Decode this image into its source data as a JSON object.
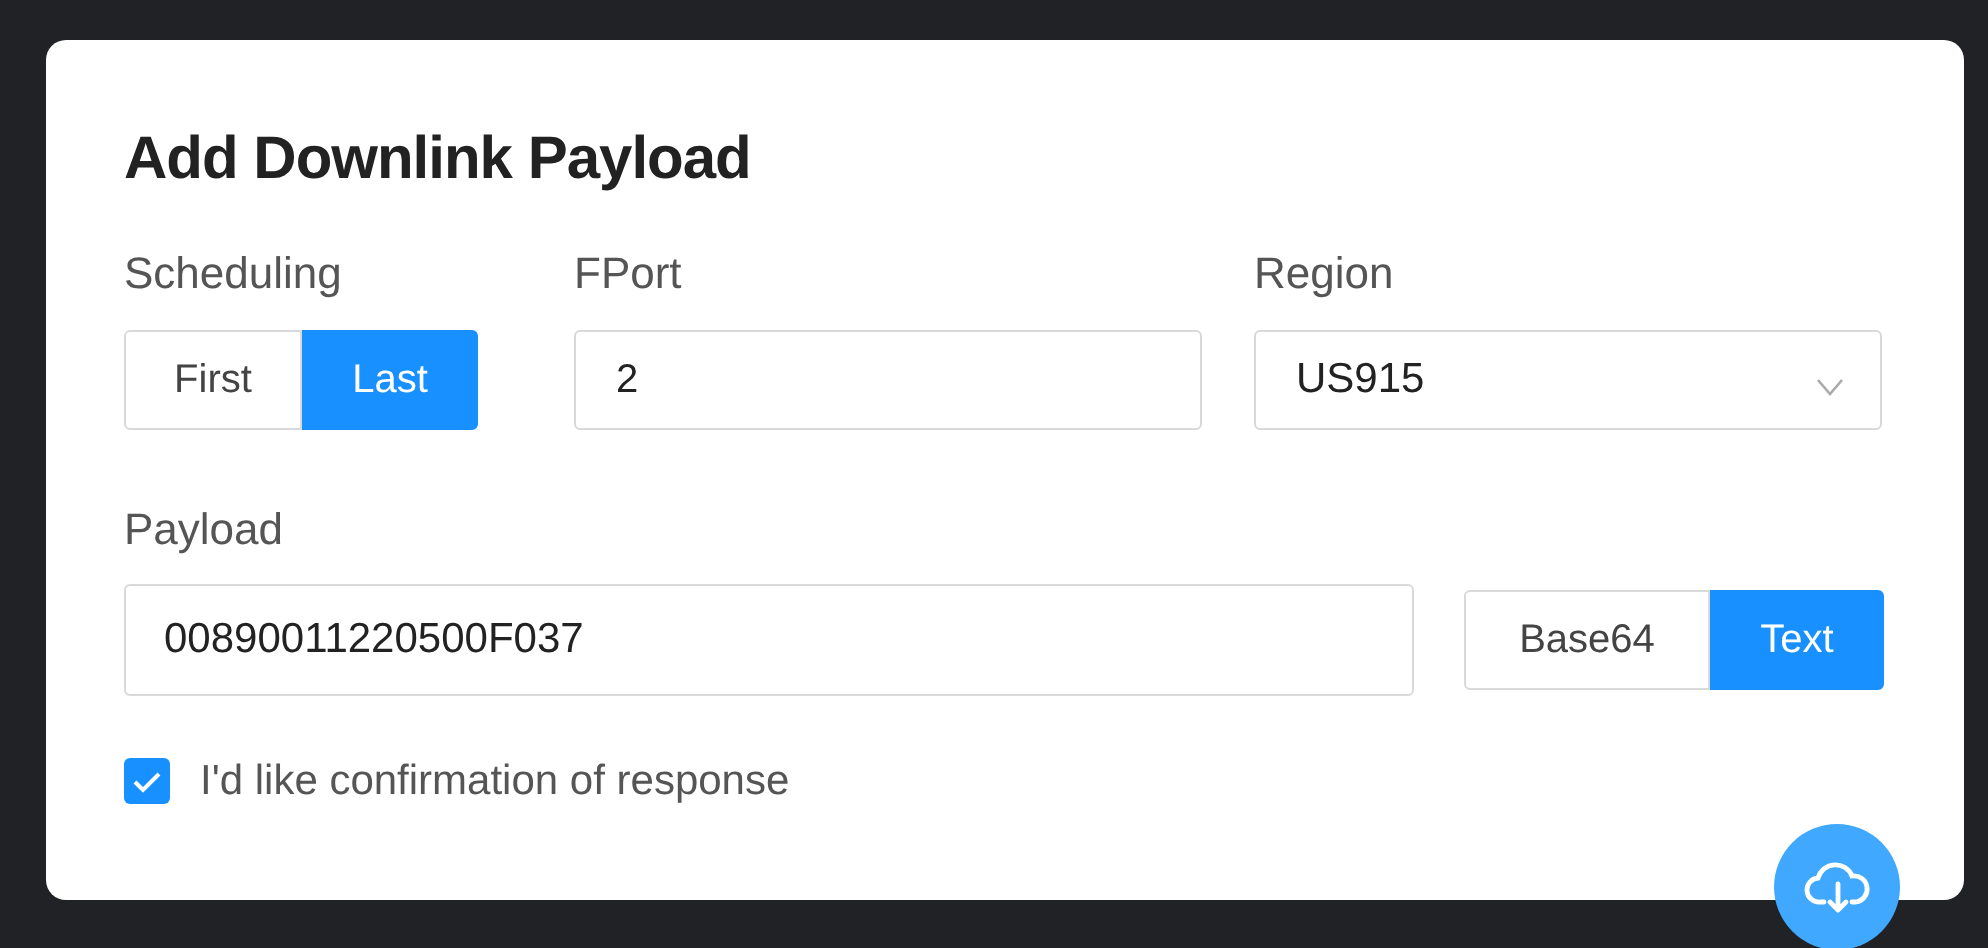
{
  "title": "Add Downlink Payload",
  "scheduling": {
    "label": "Scheduling",
    "options": [
      {
        "label": "First",
        "selected": false
      },
      {
        "label": "Last",
        "selected": true
      }
    ]
  },
  "fport": {
    "label": "FPort",
    "value": "2"
  },
  "region": {
    "label": "Region",
    "value": "US915"
  },
  "payload": {
    "label": "Payload",
    "value": "00890011220500F037",
    "formats": [
      {
        "label": "Base64",
        "selected": false
      },
      {
        "label": "Text",
        "selected": true
      }
    ]
  },
  "confirmation": {
    "label": "I'd like confirmation of response",
    "checked": true
  }
}
